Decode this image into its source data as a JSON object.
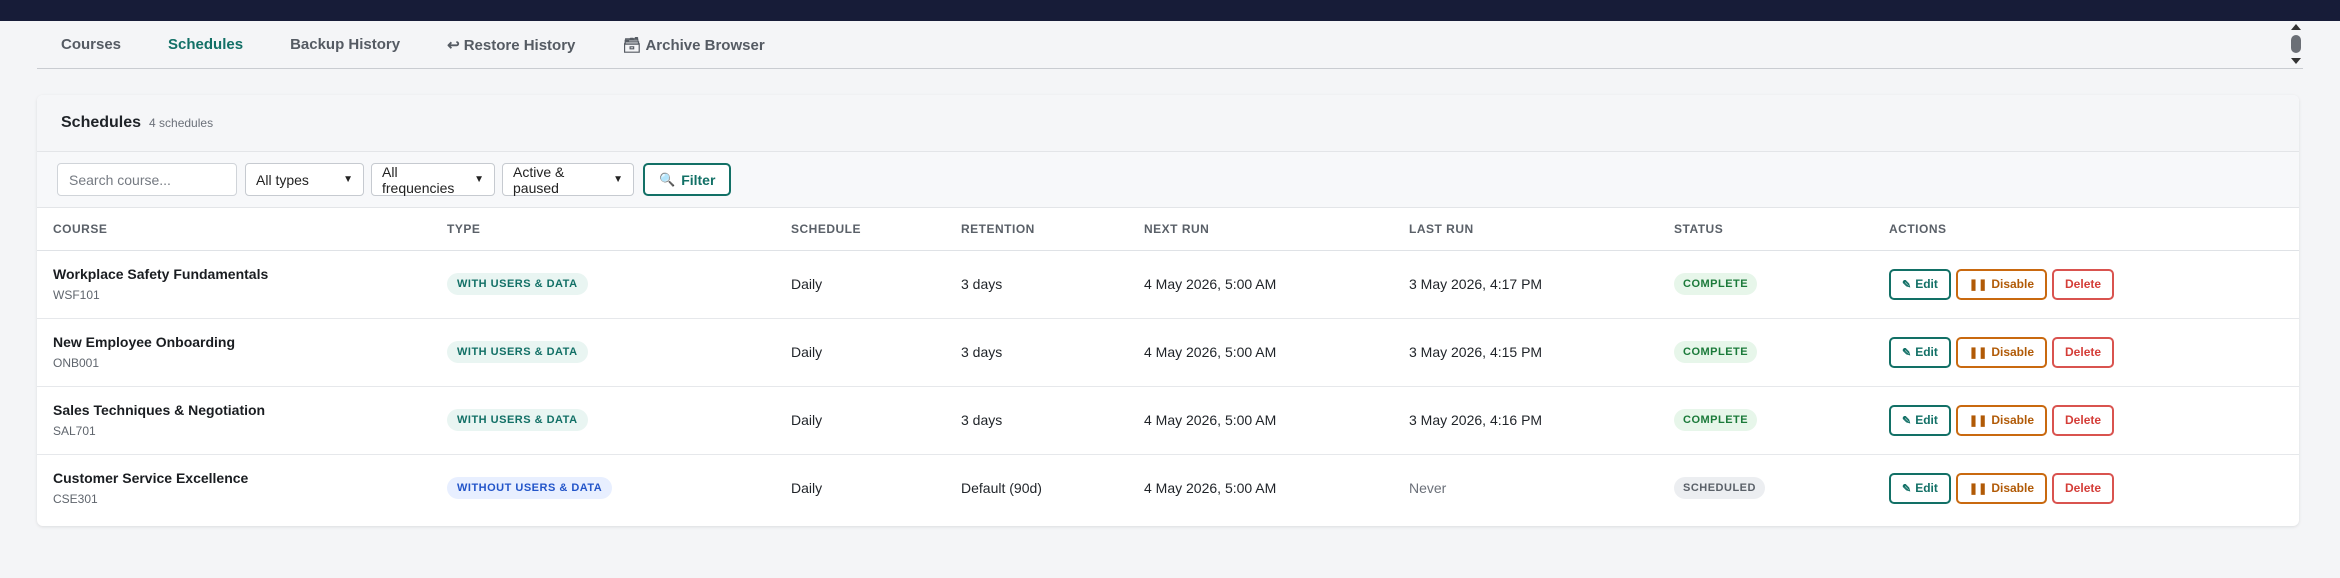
{
  "tabs": [
    {
      "label": "Courses",
      "glyph": "",
      "active": false
    },
    {
      "label": "Schedules",
      "glyph": "",
      "active": true
    },
    {
      "label": "Backup History",
      "glyph": "",
      "active": false
    },
    {
      "label": "Restore History",
      "glyph": "↩",
      "active": false
    },
    {
      "label": "Archive Browser",
      "glyph": "🗃",
      "active": false
    }
  ],
  "card": {
    "title": "Schedules",
    "count": "4 schedules"
  },
  "filters": {
    "search_placeholder": "Search course...",
    "type_select": "All types",
    "frequency_select": "All frequencies",
    "status_select": "Active & paused",
    "filter_button": "Filter",
    "filter_icon": "search-icon"
  },
  "table": {
    "headers": [
      "COURSE",
      "TYPE",
      "SCHEDULE",
      "RETENTION",
      "NEXT RUN",
      "LAST RUN",
      "STATUS",
      "ACTIONS"
    ],
    "rows": [
      {
        "name": "Workplace Safety Fundamentals",
        "code": "WSF101",
        "type": "WITH USERS & DATA",
        "type_kind": "with",
        "schedule": "Daily",
        "retention": "3 days",
        "next_run": "4 May 2026, 5:00 AM",
        "last_run": "3 May 2026, 4:17 PM",
        "last_run_muted": false,
        "status": "COMPLETE",
        "status_kind": "complete"
      },
      {
        "name": "New Employee Onboarding",
        "code": "ONB001",
        "type": "WITH USERS & DATA",
        "type_kind": "with",
        "schedule": "Daily",
        "retention": "3 days",
        "next_run": "4 May 2026, 5:00 AM",
        "last_run": "3 May 2026, 4:15 PM",
        "last_run_muted": false,
        "status": "COMPLETE",
        "status_kind": "complete"
      },
      {
        "name": "Sales Techniques & Negotiation",
        "code": "SAL701",
        "type": "WITH USERS & DATA",
        "type_kind": "with",
        "schedule": "Daily",
        "retention": "3 days",
        "next_run": "4 May 2026, 5:00 AM",
        "last_run": "3 May 2026, 4:16 PM",
        "last_run_muted": false,
        "status": "COMPLETE",
        "status_kind": "complete"
      },
      {
        "name": "Customer Service Excellence",
        "code": "CSE301",
        "type": "WITHOUT USERS & DATA",
        "type_kind": "without",
        "schedule": "Daily",
        "retention": "Default (90d)",
        "next_run": "4 May 2026, 5:00 AM",
        "last_run": "Never",
        "last_run_muted": true,
        "status": "SCHEDULED",
        "status_kind": "scheduled"
      }
    ],
    "actions": {
      "edit": "Edit",
      "disable": "Disable",
      "delete": "Delete"
    }
  },
  "colors": {
    "topbar": "#171c38",
    "accent": "#127066",
    "warning": "#c9690f",
    "danger": "#d9534f"
  }
}
